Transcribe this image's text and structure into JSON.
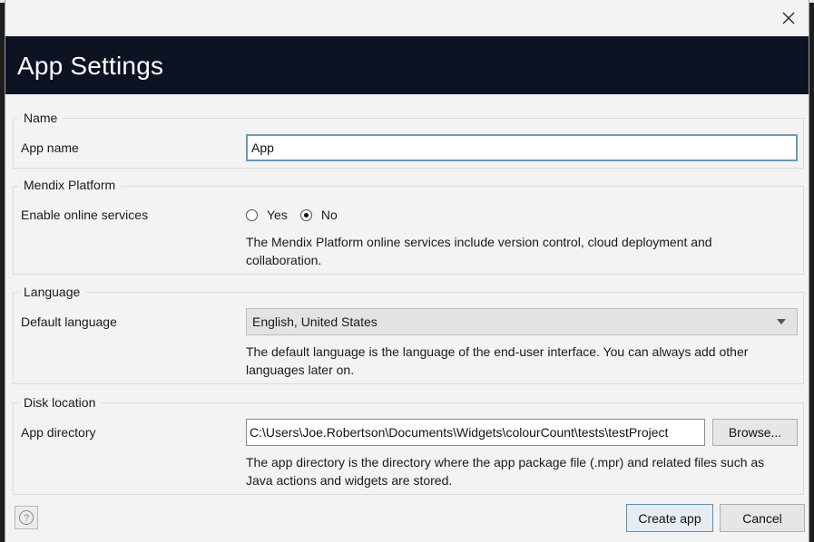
{
  "window": {
    "close_label": "×"
  },
  "header": {
    "title": "App Settings"
  },
  "name_group": {
    "legend": "Name",
    "app_name_label": "App name",
    "app_name_value": "App"
  },
  "platform_group": {
    "legend": "Mendix Platform",
    "online_label": "Enable online services",
    "yes_label": "Yes",
    "no_label": "No",
    "selected": "No",
    "description": "The Mendix Platform online services include version control, cloud deployment and collaboration."
  },
  "language_group": {
    "legend": "Language",
    "default_label": "Default language",
    "selected_language": "English, United States",
    "description": "The default language is the language of the end-user interface. You can always add other languages later on."
  },
  "disk_group": {
    "legend": "Disk location",
    "dir_label": "App directory",
    "dir_value": "C:\\Users\\Joe.Robertson\\Documents\\Widgets\\colourCount\\tests\\testProject",
    "browse_label": "Browse...",
    "description": "The app directory is the directory where the app package file (.mpr) and related files such as Java actions and widgets are stored."
  },
  "footer": {
    "help_icon": "question-circle-icon",
    "create_label": "Create app",
    "cancel_label": "Cancel"
  }
}
